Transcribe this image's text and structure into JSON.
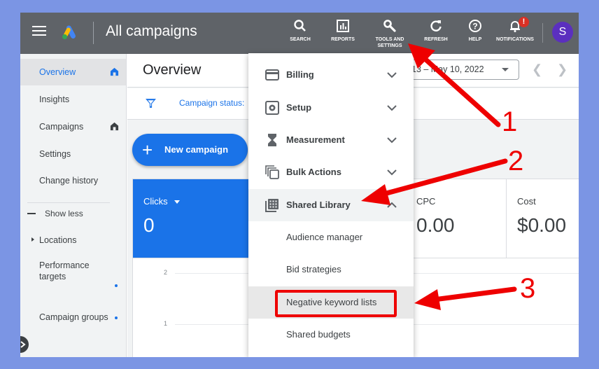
{
  "topbar": {
    "app_title": "All campaigns",
    "tools": [
      {
        "id": "search",
        "label": "SEARCH",
        "icon": "search-icon"
      },
      {
        "id": "reports",
        "label": "REPORTS",
        "icon": "reports-icon"
      },
      {
        "id": "tools",
        "label": "TOOLS AND SETTINGS",
        "icon": "wrench-icon"
      },
      {
        "id": "refresh",
        "label": "REFRESH",
        "icon": "refresh-icon"
      },
      {
        "id": "help",
        "label": "HELP",
        "icon": "help-icon"
      },
      {
        "id": "notifications",
        "label": "NOTIFICATIONS",
        "icon": "bell-icon"
      }
    ],
    "notification_badge": "!",
    "avatar_initial": "S"
  },
  "sidebar": {
    "items": [
      {
        "label": "Overview",
        "active": true,
        "icon": "home-icon"
      },
      {
        "label": "Insights"
      },
      {
        "label": "Campaigns",
        "icon": "home-icon"
      },
      {
        "label": "Settings"
      },
      {
        "label": "Change history"
      },
      {
        "label": "Show less"
      },
      {
        "label": "Locations"
      },
      {
        "label": "Performance targets",
        "dot": true
      },
      {
        "label": "Campaign groups",
        "dot": true
      }
    ]
  },
  "main": {
    "page_title": "Overview",
    "date_range": "13 – May 10, 2022",
    "filter_label": "Campaign status:",
    "new_campaign_label": "New campaign",
    "metrics": [
      {
        "label": "Clicks",
        "value": "0",
        "selected": true
      },
      {
        "label": "CPC",
        "value": "0.00"
      },
      {
        "label": "Cost",
        "value": "$0.00"
      }
    ],
    "chart_yticks": [
      "2",
      "1"
    ]
  },
  "dropdown": {
    "sections": [
      {
        "label": "Billing",
        "icon": "billing-icon",
        "expanded": false
      },
      {
        "label": "Setup",
        "icon": "setup-icon",
        "expanded": false
      },
      {
        "label": "Measurement",
        "icon": "hourglass-icon",
        "expanded": false
      },
      {
        "label": "Bulk Actions",
        "icon": "bulk-actions-icon",
        "expanded": false
      },
      {
        "label": "Shared Library",
        "icon": "shared-library-icon",
        "expanded": true
      }
    ],
    "shared_library_items": [
      "Audience manager",
      "Bid strategies",
      "Negative keyword lists",
      "Shared budgets"
    ],
    "highlighted_item": "Negative keyword lists"
  },
  "annotations": {
    "numbers": [
      "1",
      "2",
      "3"
    ],
    "color": "#ee0000"
  }
}
